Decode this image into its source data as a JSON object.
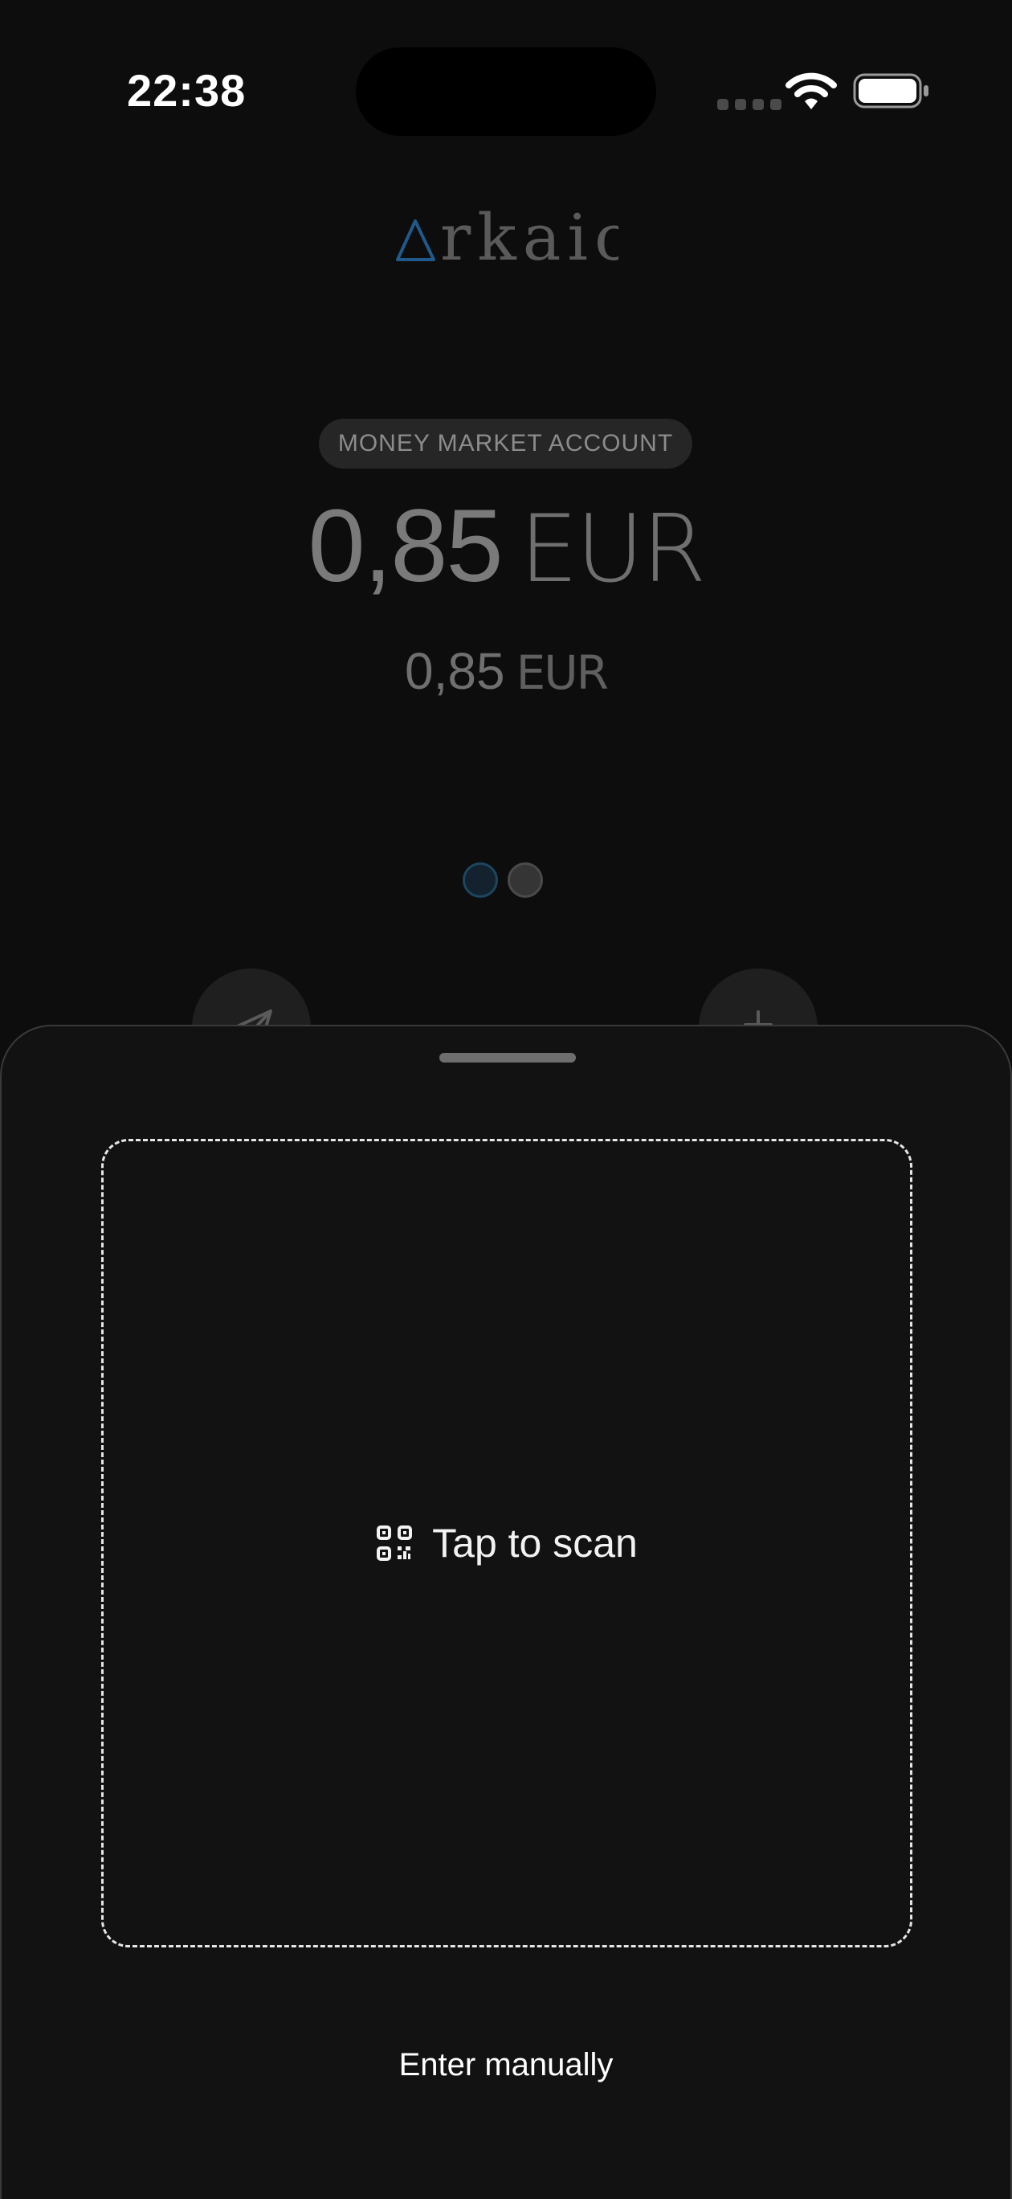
{
  "status_bar": {
    "time": "22:38",
    "icons": [
      "cellular-signal-icon",
      "wifi-icon",
      "battery-icon"
    ]
  },
  "brand": {
    "name": "rkaic",
    "accent_color": "#1f5a8a"
  },
  "account": {
    "type_label": "MONEY MARKET ACCOUNT",
    "balance_amount": "0,85",
    "balance_currency": "EUR",
    "secondary_amount": "0,85",
    "secondary_currency": "EUR"
  },
  "pager": {
    "page_count": 2,
    "active_index": 0
  },
  "actions": [
    {
      "icon": "send-icon"
    },
    {
      "icon": "plus-icon"
    }
  ],
  "sheet": {
    "scan_label": "Tap to scan",
    "scan_icon": "qr-code-icon",
    "manual_label": "Enter manually"
  },
  "colors": {
    "background": "#0d0d0d",
    "sheet": "#121212",
    "text": "#f2f2f2"
  }
}
